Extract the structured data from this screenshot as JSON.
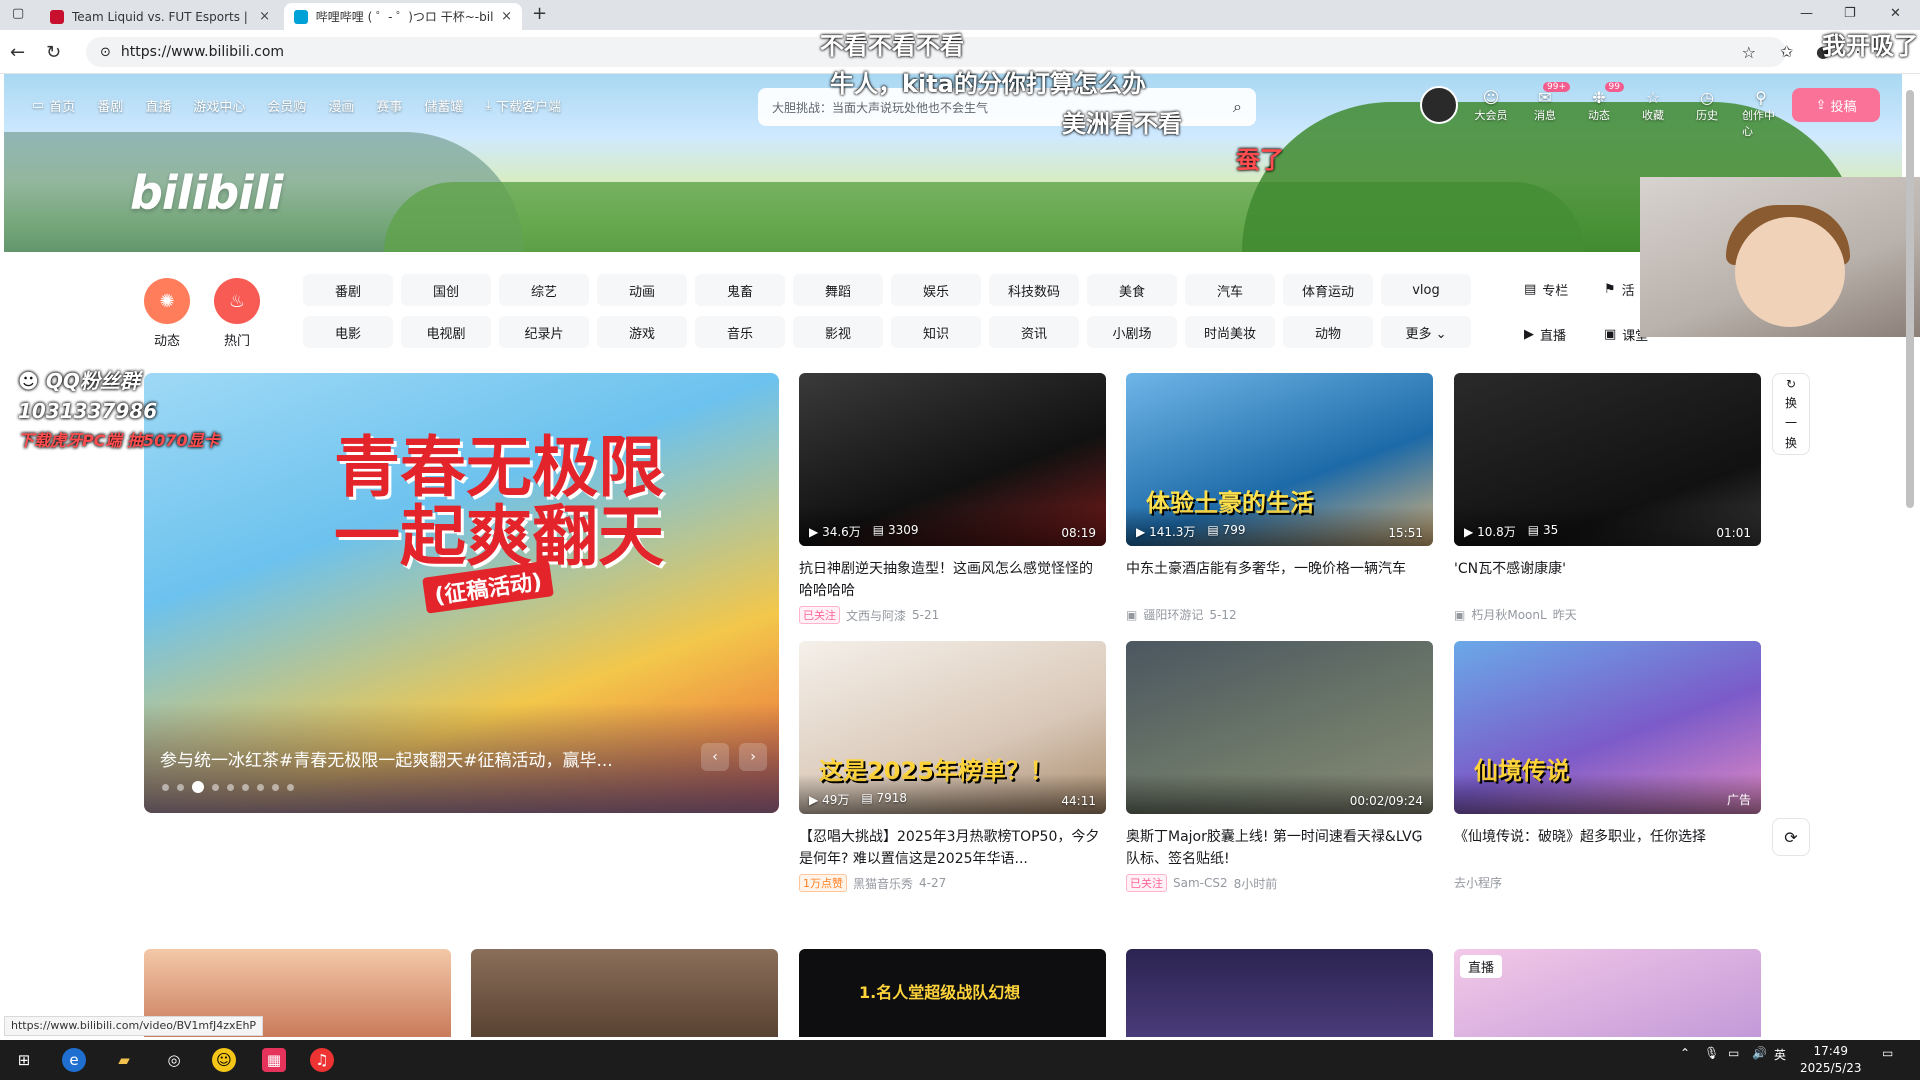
{
  "browser": {
    "tabs": [
      {
        "title": "Team Liquid vs. FUT Esports | Esp",
        "close": "×"
      },
      {
        "title": "哔哩哔哩 ( ゜- ゜)つロ 干杯~-bilib",
        "close": "×"
      }
    ],
    "new_tab": "+",
    "url": "https://www.bilibili.com",
    "window_controls": [
      "—",
      "❐",
      "✕"
    ]
  },
  "header": {
    "nav": [
      "首页",
      "番剧",
      "直播",
      "游戏中心",
      "会员购",
      "漫画",
      "赛事",
      "儲蓄罐",
      "下载客户端"
    ],
    "search_placeholder": "大胆挑战：当面大声说玩处他也不会生气",
    "logo": "bilibili",
    "icons": [
      {
        "label": "大会员",
        "glyph": "☺",
        "badge": ""
      },
      {
        "label": "消息",
        "glyph": "✉",
        "badge": "99+"
      },
      {
        "label": "动态",
        "glyph": "❉",
        "badge": "99"
      },
      {
        "label": "收藏",
        "glyph": "☆",
        "badge": ""
      },
      {
        "label": "历史",
        "glyph": "◷",
        "badge": ""
      },
      {
        "label": "创作中心",
        "glyph": "⚲",
        "badge": ""
      }
    ],
    "upload": "投稿"
  },
  "channels": {
    "dynamic": "动态",
    "hot": "热门",
    "categories": [
      "番剧",
      "国创",
      "综艺",
      "动画",
      "鬼畜",
      "舞蹈",
      "娱乐",
      "科技数码",
      "美食",
      "汽车",
      "体育运动",
      "vlog",
      "电影",
      "电视剧",
      "纪录片",
      "游戏",
      "音乐",
      "影视",
      "知识",
      "资讯",
      "小剧场",
      "时尚美妆",
      "动物",
      "更多 ⌄"
    ],
    "side": [
      "专栏",
      "活",
      "直播",
      "课堂"
    ]
  },
  "carousel": {
    "big_text_1": "青春无极限",
    "big_text_2": "一起爽翻天",
    "sub_text": "(征稿活动)",
    "caption": "参与统一冰红茶#青春无极限一起爽翻天#征稿活动，赢毕...",
    "prev": "‹",
    "next": "›",
    "dots": 9,
    "active_dot": 3
  },
  "videos": [
    {
      "views": "34.6万",
      "danmaku": "3309",
      "duration": "08:19",
      "title": "抗日神剧逆天抽象造型！这画风怎么感觉怪怪的哈哈哈哈",
      "tag": "已关注",
      "author": "文西与阿漆",
      "date": "5-21",
      "thumb_text": ""
    },
    {
      "views": "141.3万",
      "danmaku": "799",
      "duration": "15:51",
      "title": "中东土豪酒店能有多奢华，一晚价格一辆汽车",
      "tag": "",
      "author": "疆阳环游记",
      "date": "5-12",
      "thumb_text": "体验土豪的生活"
    },
    {
      "views": "10.8万",
      "danmaku": "35",
      "duration": "01:01",
      "title": "'CN瓦不感谢康康'",
      "tag": "",
      "author": "朽月秋MoonL",
      "date": "昨天",
      "thumb_text": ""
    },
    {
      "views": "49万",
      "danmaku": "7918",
      "duration": "44:11",
      "title": "【忍唱大挑战】2025年3月热歌榜TOP50，今夕是何年? 难以置信这是2025年华语...",
      "tag": "1万点赞",
      "author": "黑猫音乐秀",
      "date": "4-27",
      "thumb_text": "这是2025年榜单？！"
    },
    {
      "views": "",
      "danmaku": "",
      "duration": "00:02/09:24",
      "title": "奥斯丁Major胶囊上线! 第一时间速看天禄&LVG队标、签名贴纸!",
      "tag": "已关注",
      "author": "Sam-CS2",
      "date": "8小时前",
      "thumb_text": ""
    },
    {
      "views": "",
      "danmaku": "",
      "duration": "广告",
      "title": "《仙境传说：破晓》超多职业，任你选择",
      "tag": "",
      "author": "去小程序",
      "date": "",
      "thumb_text": "仙境传说"
    }
  ],
  "refresh_label": [
    "换",
    "一",
    "换"
  ],
  "bottom_row": {
    "live_badge": "直播",
    "bottom_text": "1.名人堂超级战队幻想"
  },
  "overlays": {
    "danmaku": [
      "不看不看不看",
      "牛人，kita的分你打算怎么办",
      "美洲看不看",
      "蚕了",
      "我开吸了"
    ],
    "qq_label": "QQ粉丝群",
    "qq_number": "1031337986",
    "qq_note": "下载虎牙PC端 抽5070显卡"
  },
  "status_url": "https://www.bilibili.com/video/BV1mfJ4zxEhP",
  "taskbar": {
    "time": "17:49",
    "date": "2025/5/23",
    "lang": "英"
  },
  "colors": {
    "brand_pink": "#fb7299",
    "tag_pink": "#ff6699",
    "hot_red": "#f85a54"
  }
}
